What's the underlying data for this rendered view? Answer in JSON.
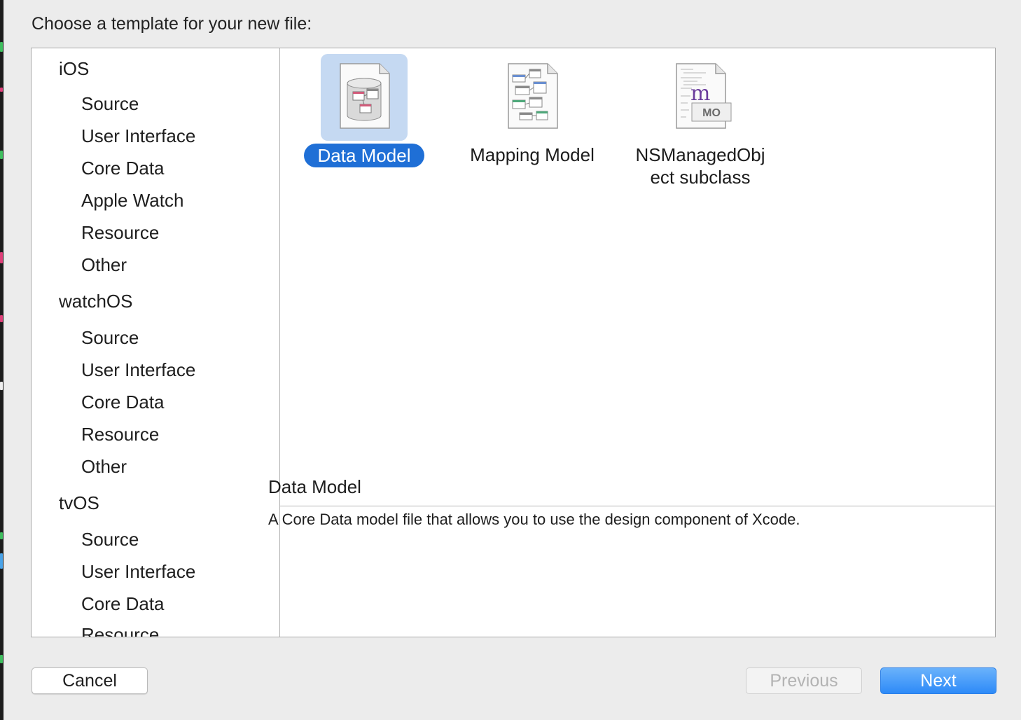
{
  "dialog": {
    "heading": "Choose a template for your new file:"
  },
  "sidebar": {
    "rows": [
      {
        "label": "iOS",
        "kind": "platform"
      },
      {
        "label": "Source",
        "kind": "sub"
      },
      {
        "label": "User Interface",
        "kind": "sub"
      },
      {
        "label": "Core Data",
        "kind": "sub"
      },
      {
        "label": "Apple Watch",
        "kind": "sub"
      },
      {
        "label": "Resource",
        "kind": "sub"
      },
      {
        "label": "Other",
        "kind": "sub"
      },
      {
        "label": "watchOS",
        "kind": "platform"
      },
      {
        "label": "Source",
        "kind": "sub"
      },
      {
        "label": "User Interface",
        "kind": "sub"
      },
      {
        "label": "Core Data",
        "kind": "sub"
      },
      {
        "label": "Resource",
        "kind": "sub"
      },
      {
        "label": "Other",
        "kind": "sub"
      },
      {
        "label": "tvOS",
        "kind": "platform"
      },
      {
        "label": "Source",
        "kind": "sub"
      },
      {
        "label": "User Interface",
        "kind": "sub"
      },
      {
        "label": "Core Data",
        "kind": "sub"
      },
      {
        "label": "Resource",
        "kind": "sub"
      }
    ]
  },
  "templates": [
    {
      "label": "Data Model",
      "icon": "data-model-icon",
      "selected": true
    },
    {
      "label": "Mapping Model",
      "icon": "mapping-model-icon",
      "selected": false
    },
    {
      "label_line1": "NSManagedObj",
      "label_line2": "ect subclass",
      "icon": "managed-object-icon",
      "badge": "MO",
      "glyph": "m",
      "selected": false
    }
  ],
  "description": {
    "title": "Data Model",
    "body": "A Core Data model file that allows you to use the design component of Xcode."
  },
  "buttons": {
    "cancel": "Cancel",
    "previous": "Previous",
    "next": "Next"
  },
  "colors": {
    "selection_pill": "#1f6fd6",
    "selection_tile": "#c5d9f2",
    "primary_button": "#2d8af8"
  }
}
